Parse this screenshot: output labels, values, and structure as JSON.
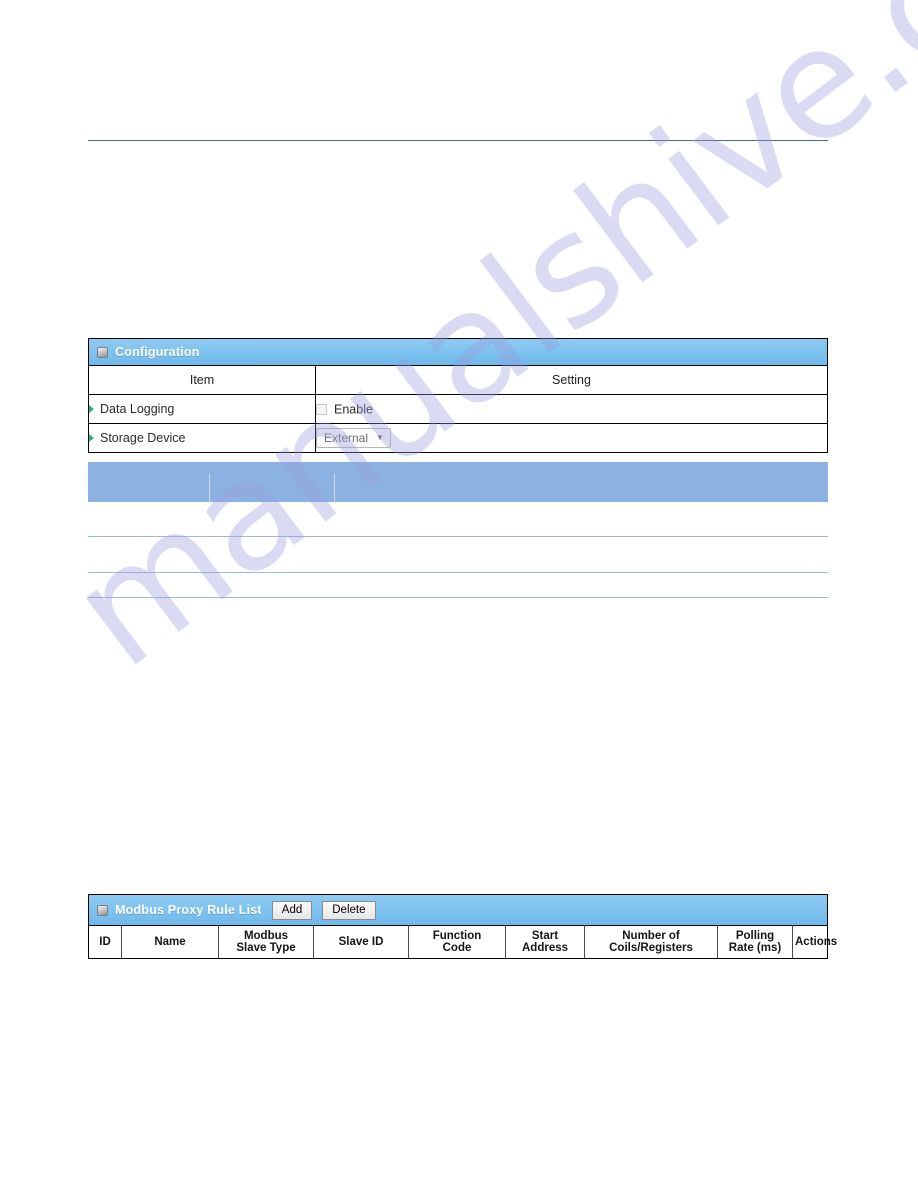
{
  "watermark": {
    "text": "manualshive.com",
    "color": "#9a9ddd"
  },
  "configuration": {
    "title": "Configuration",
    "icon": "window-icon",
    "columns": {
      "item": "Item",
      "setting": "Setting"
    },
    "rows": [
      {
        "label": "Data Logging",
        "control": "checkbox",
        "checkbox_label": "Enable",
        "checked": false
      },
      {
        "label": "Storage Device",
        "control": "select",
        "selected": "External",
        "caret": "▼"
      }
    ]
  },
  "blank_list": {
    "header_color": "#8cb2e2",
    "columns": [
      "",
      "",
      ""
    ],
    "rows": [
      [
        "",
        "",
        ""
      ],
      [
        "",
        "",
        ""
      ],
      [
        "",
        "",
        ""
      ]
    ]
  },
  "modbus_proxy_rule_list": {
    "title": "Modbus Proxy Rule List",
    "icon": "window-icon",
    "buttons": {
      "add": "Add",
      "delete": "Delete"
    },
    "columns": [
      {
        "id": "id",
        "line1": "ID",
        "line2": ""
      },
      {
        "id": "name",
        "line1": "Name",
        "line2": ""
      },
      {
        "id": "modbus-slave-type",
        "line1": "Modbus",
        "line2": "Slave Type"
      },
      {
        "id": "slave-id",
        "line1": "Slave ID",
        "line2": ""
      },
      {
        "id": "function-code",
        "line1": "Function",
        "line2": "Code"
      },
      {
        "id": "start-address",
        "line1": "Start",
        "line2": "Address"
      },
      {
        "id": "number-of-coils-registers",
        "line1": "Number of",
        "line2": "Coils/Registers"
      },
      {
        "id": "polling-rate",
        "line1": "Polling",
        "line2": "Rate (ms)"
      },
      {
        "id": "actions",
        "line1": "Actions",
        "line2": ""
      }
    ],
    "rows": []
  },
  "colors": {
    "panel_header_blue": "#7bc0ef",
    "secondary_header_blue": "#8cb2e2",
    "rule_border": "#9dbbd8",
    "bullet_green": "#2fae8e",
    "top_rule": "#4a6a86"
  }
}
